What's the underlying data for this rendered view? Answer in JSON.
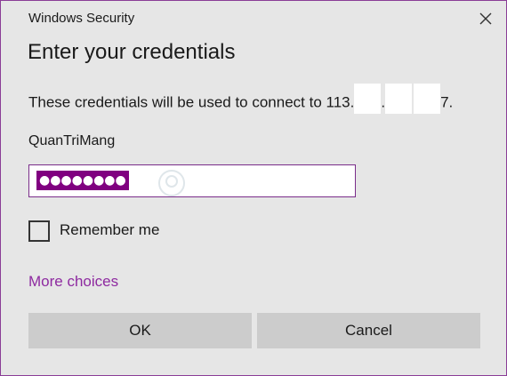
{
  "window": {
    "title": "Windows Security",
    "close_icon": "close-icon"
  },
  "dialog": {
    "heading": "Enter your credentials",
    "description_prefix": "These credentials will be used to connect to 113.",
    "description_sep1": ".",
    "description_suffix": "7.",
    "username": "QuanTriMang",
    "password_masked": "●●●●●●●●",
    "remember_label": "Remember me",
    "remember_checked": false,
    "more_choices": "More choices"
  },
  "buttons": {
    "ok": "OK",
    "cancel": "Cancel"
  },
  "colors": {
    "accent": "#8e2aa0",
    "selection": "#800080",
    "button_bg": "#cccccc",
    "dialog_bg": "#e6e6e6"
  }
}
